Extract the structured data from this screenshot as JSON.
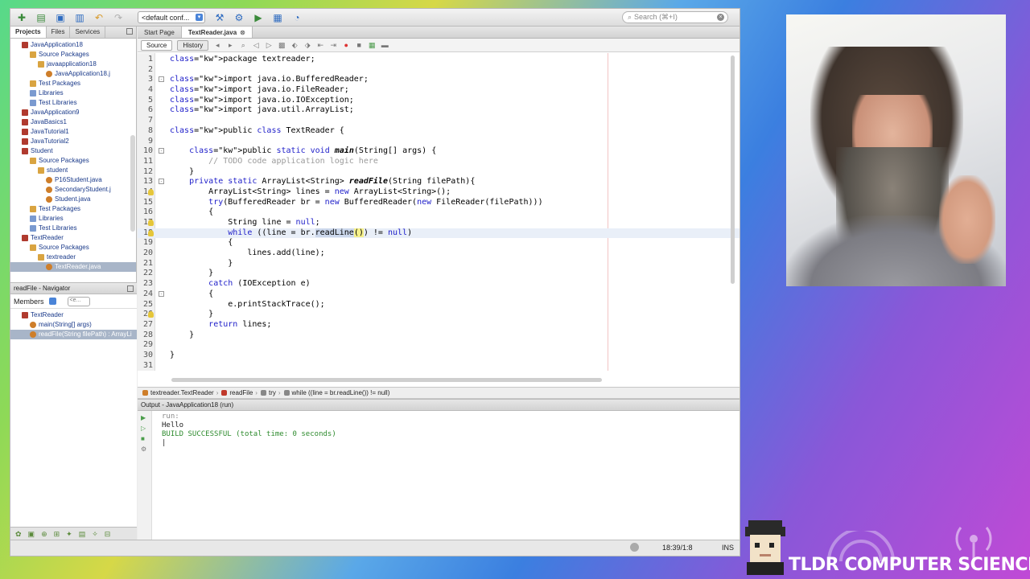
{
  "toolbar": {
    "config": "<default conf...",
    "search_placeholder": "Search (⌘+I)"
  },
  "left_panel": {
    "tabs": [
      "Projects",
      "Files",
      "Services"
    ],
    "tree": [
      {
        "label": "JavaApplication18",
        "indent": 1,
        "icon": "proj"
      },
      {
        "label": "Source Packages",
        "indent": 2,
        "icon": "pkg"
      },
      {
        "label": "javaapplication18",
        "indent": 3,
        "icon": "pkg"
      },
      {
        "label": "JavaApplication18.j",
        "indent": 4,
        "icon": "java"
      },
      {
        "label": "Test Packages",
        "indent": 2,
        "icon": "pkg"
      },
      {
        "label": "Libraries",
        "indent": 2,
        "icon": "lib"
      },
      {
        "label": "Test Libraries",
        "indent": 2,
        "icon": "lib"
      },
      {
        "label": "JavaApplication9",
        "indent": 1,
        "icon": "proj"
      },
      {
        "label": "JavaBasics1",
        "indent": 1,
        "icon": "proj"
      },
      {
        "label": "JavaTutorial1",
        "indent": 1,
        "icon": "proj"
      },
      {
        "label": "JavaTutorial2",
        "indent": 1,
        "icon": "proj"
      },
      {
        "label": "Student",
        "indent": 1,
        "icon": "proj"
      },
      {
        "label": "Source Packages",
        "indent": 2,
        "icon": "pkg"
      },
      {
        "label": "student",
        "indent": 3,
        "icon": "pkg"
      },
      {
        "label": "P16Student.java",
        "indent": 4,
        "icon": "java"
      },
      {
        "label": "SecondaryStudent.j",
        "indent": 4,
        "icon": "java"
      },
      {
        "label": "Student.java",
        "indent": 4,
        "icon": "java"
      },
      {
        "label": "Test Packages",
        "indent": 2,
        "icon": "pkg"
      },
      {
        "label": "Libraries",
        "indent": 2,
        "icon": "lib"
      },
      {
        "label": "Test Libraries",
        "indent": 2,
        "icon": "lib"
      },
      {
        "label": "TextReader",
        "indent": 1,
        "icon": "proj"
      },
      {
        "label": "Source Packages",
        "indent": 2,
        "icon": "pkg"
      },
      {
        "label": "textreader",
        "indent": 3,
        "icon": "pkg"
      },
      {
        "label": "TextReader.java",
        "indent": 4,
        "icon": "java",
        "selected": true
      }
    ]
  },
  "navigator": {
    "title": "readFile - Navigator",
    "members_label": "Members",
    "filter": "<e...",
    "items": [
      {
        "label": "TextReader",
        "indent": 1
      },
      {
        "label": "main(String[] args)",
        "indent": 2
      },
      {
        "label": "readFile(String filePath) : ArrayLi",
        "indent": 2,
        "selected": true
      }
    ]
  },
  "editor": {
    "tabs": [
      "Start Page",
      "TextReader.java"
    ],
    "source_label": "Source",
    "history_label": "History",
    "lines": [
      "package textreader;",
      "",
      "import java.io.BufferedReader;",
      "import java.io.FileReader;",
      "import java.io.IOException;",
      "import java.util.ArrayList;",
      "",
      "public class TextReader {",
      "",
      "    public static void main(String[] args) {",
      "        // TODO code application logic here",
      "    }",
      "    private static ArrayList<String> readFile(String filePath){",
      "        ArrayList<String> lines = new ArrayList<String>();",
      "        try(BufferedReader br = new BufferedReader(new FileReader(filePath)))",
      "        {",
      "            String line = null;",
      "            while ((line = br.readLine()) != null)",
      "            {",
      "                lines.add(line);",
      "            }",
      "        }",
      "        catch (IOException e)",
      "        {",
      "            e.printStackTrace();",
      "        }",
      "        return lines;",
      "    }",
      "",
      "}",
      ""
    ],
    "highlighted_line": 18
  },
  "breadcrumb": [
    "textreader.TextReader",
    "readFile",
    "try",
    "while ((line = br.readLine()) != null)"
  ],
  "output": {
    "title": "Output - JavaApplication18 (run)",
    "lines": [
      "run:",
      "Hello",
      "BUILD SUCCESSFUL (total time: 0 seconds)"
    ]
  },
  "status": {
    "position": "18:39/1:8",
    "mode": "INS"
  },
  "branding": {
    "text": "TLDR COMPUTER SCIENCE"
  },
  "colors": {
    "keyword": "#1d1dc9",
    "comment": "#9a9a9a",
    "build_success": "#2e8b2e"
  }
}
